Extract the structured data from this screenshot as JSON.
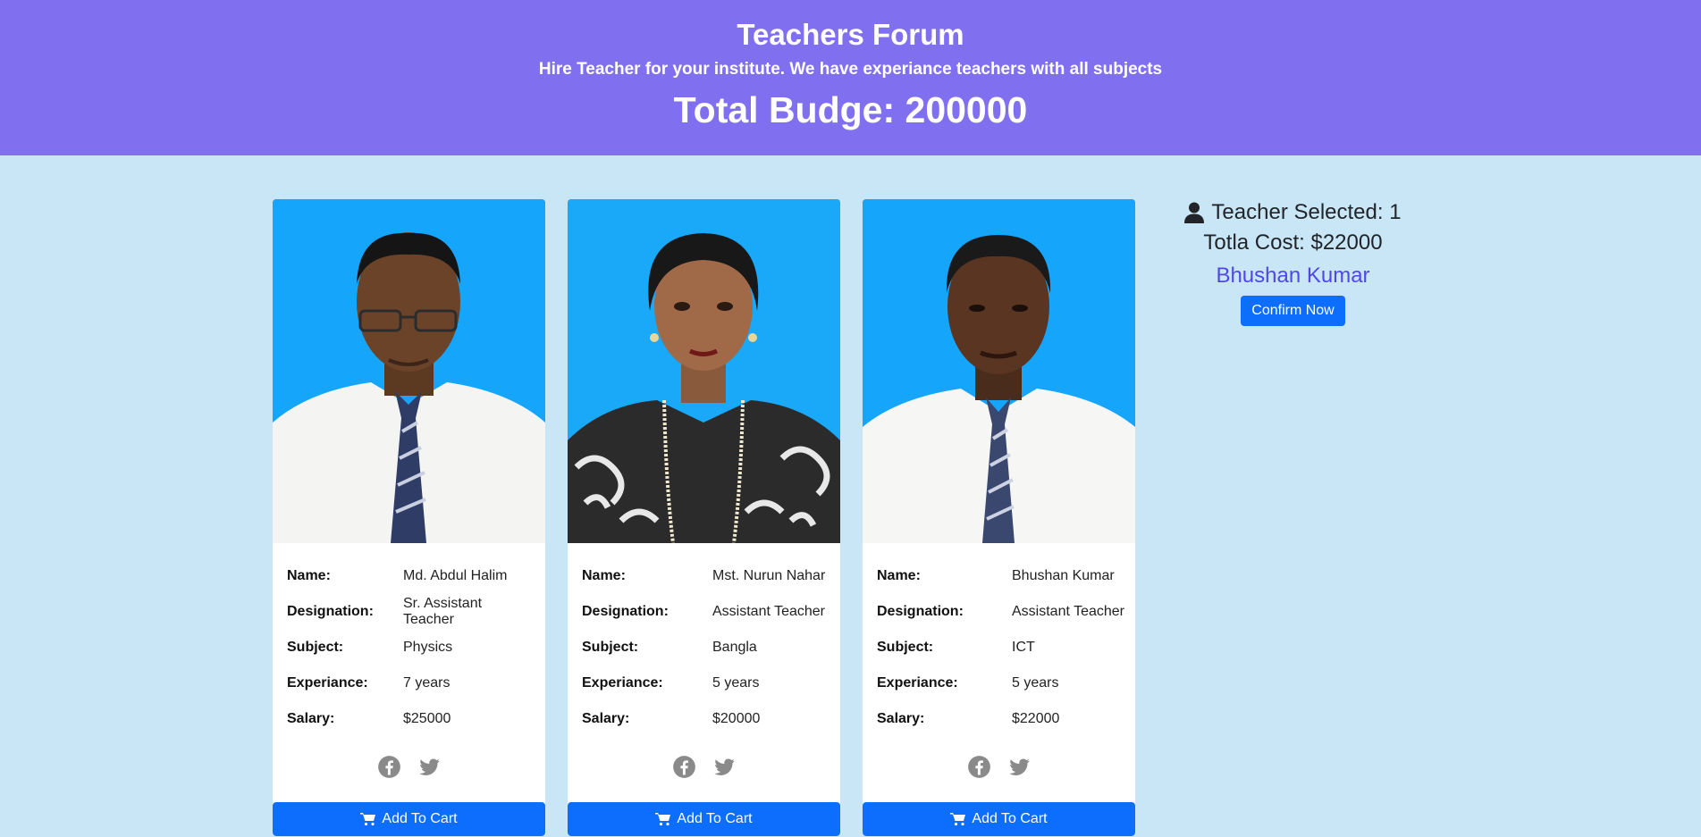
{
  "header": {
    "title": "Teachers Forum",
    "subtitle": "Hire Teacher for your institute. We have experiance teachers with all subjects",
    "budget": "Total Budge: 200000"
  },
  "labels": {
    "name": "Name:",
    "designation": "Designation:",
    "subject": "Subject:",
    "experience": "Experiance:",
    "salary": "Salary:"
  },
  "teachers": [
    {
      "name": "Md. Abdul Halim",
      "designation": "Sr. Assistant Teacher",
      "subject": "Physics",
      "experience": "7 years",
      "salary": "$25000",
      "cart_label": "Add To Cart"
    },
    {
      "name": "Mst. Nurun Nahar",
      "designation": "Assistant Teacher",
      "subject": "Bangla",
      "experience": "5 years",
      "salary": "$20000",
      "cart_label": "Add To Cart"
    },
    {
      "name": "Bhushan Kumar",
      "designation": "Assistant Teacher",
      "subject": "ICT",
      "experience": "5 years",
      "salary": "$22000",
      "cart_label": "Add To Cart"
    }
  ],
  "summary": {
    "selected": "Teacher Selected: 1",
    "total_cost": "Totla Cost: $22000",
    "selected_name": "Bhushan Kumar",
    "confirm_label": "Confirm Now"
  },
  "icons": {
    "social": [
      "facebook-icon",
      "twitter-icon"
    ],
    "cart": "cart-icon",
    "user": "user-icon"
  },
  "colors": {
    "header_bg": "#8070f0",
    "page_bg": "#c9e6f6",
    "photo_bg": "#15a6fc",
    "primary": "#0d6efd",
    "selected_name": "#4f48e6"
  }
}
